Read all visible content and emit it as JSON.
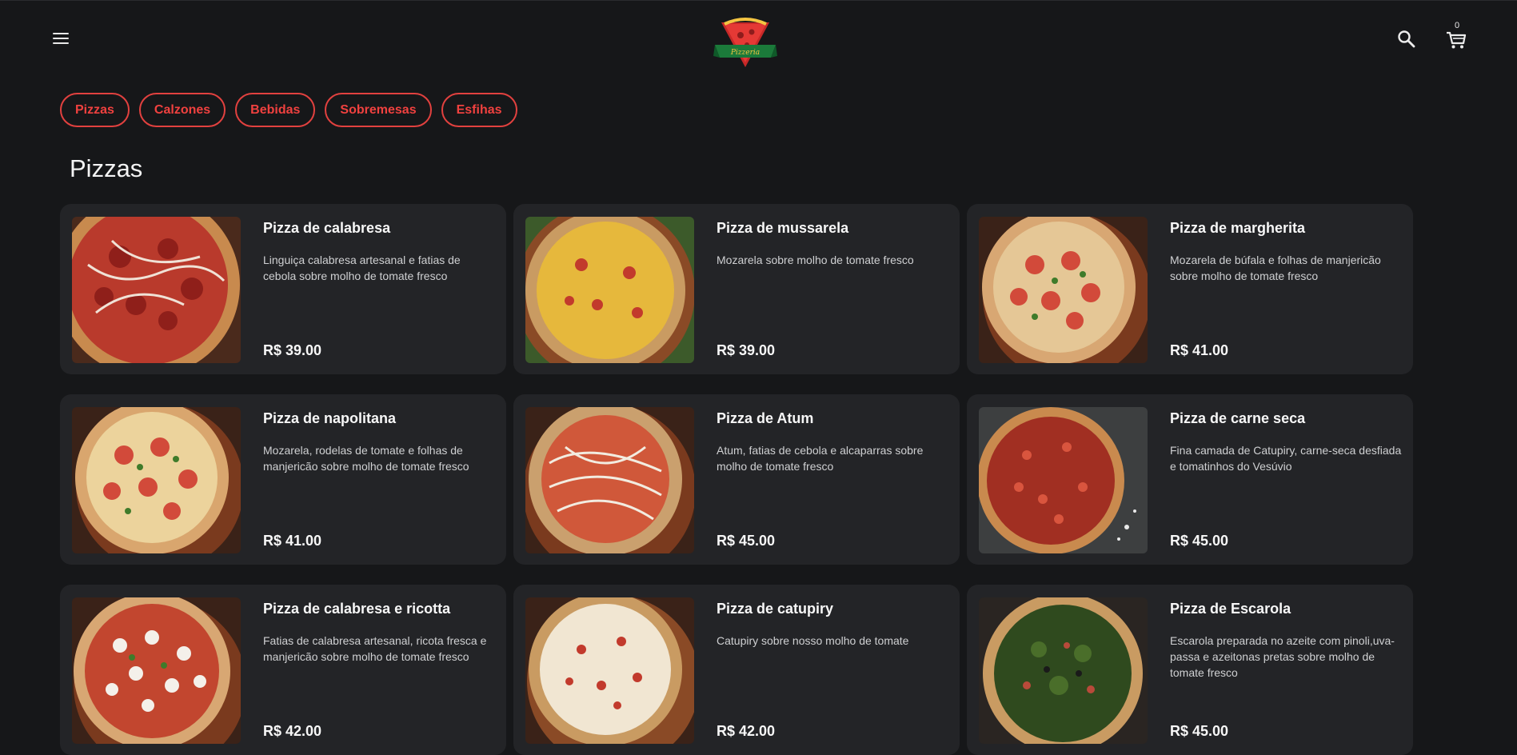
{
  "header": {
    "menu_icon": "hamburger-menu-icon",
    "logo_icon": "pizzeria-logo",
    "search_icon": "search-icon",
    "cart_icon": "cart-icon",
    "cart_count": "0"
  },
  "categories": [
    "Pizzas",
    "Calzones",
    "Bebidas",
    "Sobremesas",
    "Esfihas"
  ],
  "section_title": "Pizzas",
  "colors": {
    "accent": "#e2413f",
    "background": "#161719",
    "card": "#232427"
  },
  "products": [
    {
      "name": "Pizza de calabresa",
      "description": "Linguiça calabresa artesanal e fatias de cebola sobre molho de tomate fresco",
      "price": "R$ 39.00"
    },
    {
      "name": "Pizza de mussarela",
      "description": "Mozarela sobre molho de tomate fresco",
      "price": "R$ 39.00"
    },
    {
      "name": "Pizza de margherita",
      "description": "Mozarela de búfala e folhas de manjericão sobre molho de tomate fresco",
      "price": "R$ 41.00"
    },
    {
      "name": "Pizza de napolitana",
      "description": "Mozarela, rodelas de tomate e folhas de manjericão sobre molho de tomate fresco",
      "price": "R$ 41.00"
    },
    {
      "name": "Pizza de Atum",
      "description": "Atum, fatias de cebola e alcaparras sobre molho de tomate fresco",
      "price": "R$ 45.00"
    },
    {
      "name": "Pizza de carne seca",
      "description": "Fina camada de Catupiry, carne-seca desfiada e tomatinhos do Vesúvio",
      "price": "R$ 45.00"
    },
    {
      "name": "Pizza de calabresa e ricotta",
      "description": "Fatias de calabresa artesanal, ricota fresca e manjericão sobre molho de tomate fresco",
      "price": "R$ 42.00"
    },
    {
      "name": "Pizza de catupiry",
      "description": "Catupiry sobre nosso molho de tomate",
      "price": "R$ 42.00"
    },
    {
      "name": "Pizza de Escarola",
      "description": "Escarola preparada no azeite com pinoli,uva-passa e azeitonas pretas sobre molho de tomate fresco",
      "price": "R$ 45.00"
    }
  ]
}
